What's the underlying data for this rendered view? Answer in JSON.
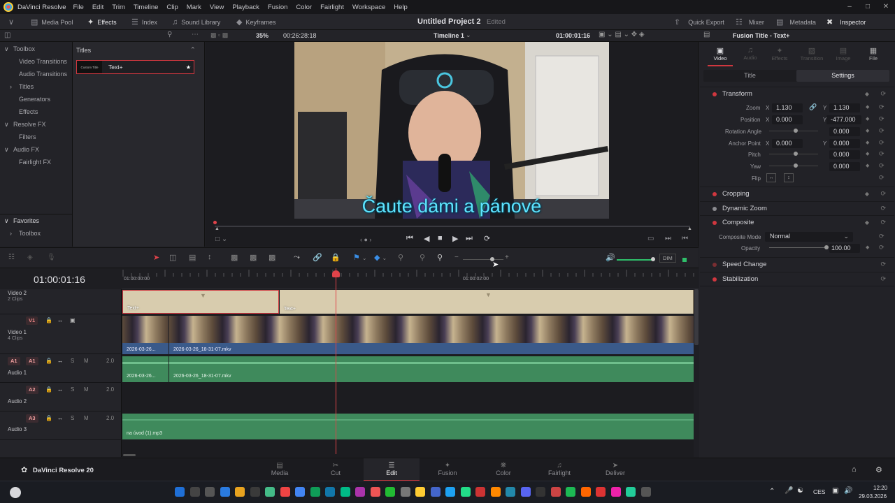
{
  "app": {
    "name": "DaVinci Resolve"
  },
  "menu": [
    "File",
    "Edit",
    "Trim",
    "Timeline",
    "Clip",
    "Mark",
    "View",
    "Playback",
    "Fusion",
    "Color",
    "Fairlight",
    "Workspace",
    "Help"
  ],
  "toolbar": {
    "media_pool": "Media Pool",
    "effects": "Effects",
    "index": "Index",
    "sound_library": "Sound Library",
    "keyframes": "Keyframes",
    "project_title": "Untitled Project 2",
    "edited": "Edited",
    "quick_export": "Quick Export",
    "mixer": "Mixer",
    "metadata": "Metadata",
    "inspector": "Inspector"
  },
  "bar2": {
    "zoom": "35%",
    "timecode_duration": "00:26:28:18",
    "timeline_name": "Timeline 1",
    "timecode_current": "01:00:01:16",
    "inspector_title": "Fusion Title - Text+"
  },
  "effects_panel": {
    "toolbox": "Toolbox",
    "items": [
      "Video Transitions",
      "Audio Transitions",
      "Titles",
      "Generators",
      "Effects"
    ],
    "resolve_fx": "Resolve FX",
    "filters": "Filters",
    "audio_fx": "Audio FX",
    "fairlight_fx": "Fairlight FX",
    "favorites": "Favorites",
    "fav_toolbox": "Toolbox"
  },
  "titles_panel": {
    "heading": "Titles",
    "tile_thumb": "Custom Title",
    "tile_label": "Text+"
  },
  "viewer": {
    "subtitle": "Čaute dámi a pánové"
  },
  "inspector": {
    "tabs": [
      "Video",
      "Audio",
      "Effects",
      "Transition",
      "Image",
      "File"
    ],
    "subtabs": [
      "Title",
      "Settings"
    ],
    "transform": "Transform",
    "zoom_lbl": "Zoom",
    "zoom_x": "1.130",
    "zoom_y": "1.130",
    "pos_lbl": "Position",
    "pos_x": "0.000",
    "pos_y": "-477.000",
    "rot_lbl": "Rotation Angle",
    "rot": "0.000",
    "anchor_lbl": "Anchor Point",
    "anchor_x": "0.000",
    "anchor_y": "0.000",
    "pitch_lbl": "Pitch",
    "pitch": "0.000",
    "yaw_lbl": "Yaw",
    "yaw": "0.000",
    "flip_lbl": "Flip",
    "x": "X",
    "y": "Y",
    "cropping": "Cropping",
    "dynamic_zoom": "Dynamic Zoom",
    "composite": "Composite",
    "comp_mode_lbl": "Composite Mode",
    "comp_mode": "Normal",
    "opacity_lbl": "Opacity",
    "opacity": "100.00",
    "speed_change": "Speed Change",
    "stabilization": "Stabilization"
  },
  "timeline": {
    "timecode": "01:00:01:16",
    "ruler_start": "01:00:00:00",
    "ruler_mid": "01:00:02:00",
    "dim": "DIM",
    "tracks": {
      "v2_name": "Video 2",
      "v2_sub": "2 Clips",
      "v1_tag": "V1",
      "v1_name": "Video 1",
      "v1_sub": "4 Clips",
      "a1_tag_out": "A1",
      "a1_tag": "A1",
      "a1_name": "Audio 1",
      "a1_ch": "2.0",
      "a2_tag": "A2",
      "a2_name": "Audio 2",
      "a2_ch": "2.0",
      "a3_tag": "A3",
      "a3_name": "Audio 3",
      "a3_ch": "2.0",
      "s": "S",
      "m": "M"
    },
    "clips": {
      "title1": "Text+",
      "title2": "Text+",
      "video1": "2026-03-26...",
      "video2": "2026-03-26_18-31-07.mkv",
      "audio1": "2026-03-26...",
      "audio2": "2026-03-26_18-31-07.mkv",
      "audio3": "na úvod (1).mp3"
    }
  },
  "pages": {
    "brand": "DaVinci Resolve 20",
    "items": [
      "Media",
      "Cut",
      "Edit",
      "Fusion",
      "Color",
      "Fairlight",
      "Deliver"
    ],
    "active": "Edit"
  },
  "taskbar": {
    "lang": "CES",
    "time": "12:20",
    "date": "29.03.2026"
  },
  "colors": {
    "accent": "#d0373f",
    "subtitle": "#5ee4ff",
    "video_clip": "#3a5a8a",
    "audio_clip": "#3f8a5c",
    "title_clip": "#d8ccae"
  }
}
